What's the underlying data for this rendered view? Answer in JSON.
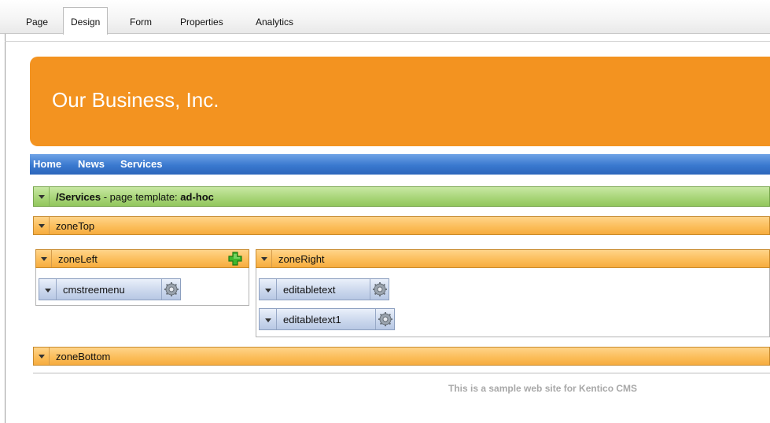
{
  "tabs": [
    {
      "label": "Page",
      "active": false
    },
    {
      "label": "Design",
      "active": true
    },
    {
      "label": "Form",
      "active": false
    },
    {
      "label": "Properties",
      "active": false
    },
    {
      "label": "Analytics",
      "active": false
    }
  ],
  "site": {
    "title": "Our Business, Inc.",
    "nav": [
      "Home",
      "News",
      "Services"
    ],
    "footer": "This is a sample web site for Kentico CMS"
  },
  "template_bar": {
    "path": "/Services",
    "separator": " - page template: ",
    "template": "ad-hoc"
  },
  "zones": {
    "top": "zoneTop",
    "left": "zoneLeft",
    "right": "zoneRight",
    "bottom": "zoneBottom"
  },
  "webparts": {
    "left": [
      "cmstreemenu"
    ],
    "right": [
      "editabletext",
      "editabletext1"
    ]
  },
  "colors": {
    "banner": "#f39320",
    "nav": "#3a79cf",
    "zone": "#fbbc57",
    "template": "#a6d476",
    "webpart": "#c9d6ec"
  },
  "icons": {
    "zone_menu": "triangle-down-icon",
    "webpart_properties": "gear-icon",
    "add_webpart": "plus-icon"
  }
}
